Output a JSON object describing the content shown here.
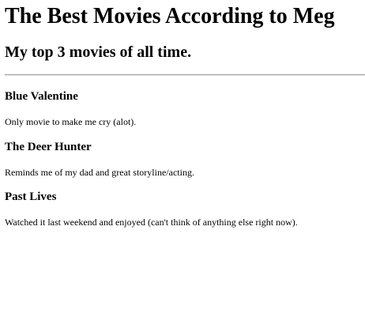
{
  "page": {
    "title": "The Best Movies According to Meg",
    "subtitle": "My top 3 movies of all time."
  },
  "movies": [
    {
      "title": "Blue Valentine",
      "description": "Only movie to make me cry (alot)."
    },
    {
      "title": "The Deer Hunter",
      "description": "Reminds me of my dad and great storyline/acting."
    },
    {
      "title": "Past Lives",
      "description": "Watched it last weekend and enjoyed (can't think of anything else right now)."
    }
  ]
}
